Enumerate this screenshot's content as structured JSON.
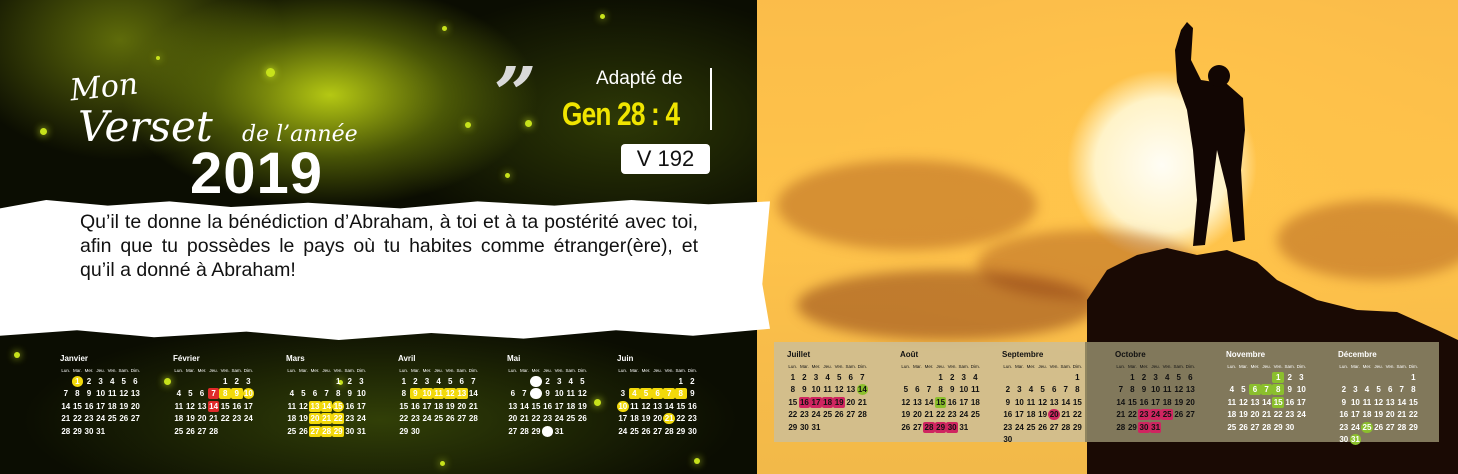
{
  "header": {
    "title_mon": "Mon",
    "title_verset": "Verset",
    "title_annee": "de l’année",
    "year": "2019",
    "quote_mark": "”",
    "adapted_label": "Adapté de",
    "reference": "Gen 28 : 4",
    "version": "V 192"
  },
  "verse": {
    "text": "Qu’il te donne la bénédiction d’Abraham, à toi et à ta postérité avec toi, afin que tu possèdes le pays où tu habites comme étranger(ère), et qu’il a donné à Abraham!"
  },
  "weekdays": [
    "Lun.",
    "Mar.",
    "Mer.",
    "Jeu.",
    "Ven.",
    "Sam.",
    "Dim."
  ],
  "colors": {
    "accent_yellow": "#f2d90b",
    "accent_red": "#e02a2a",
    "accent_green": "#8bbf2d",
    "accent_pink": "#cf2560",
    "reference_yellow": "#f0e500"
  },
  "calendar": {
    "months": [
      {
        "name": "Janvier",
        "weeks": [
          [
            "",
            "1",
            "2",
            "3",
            "4",
            "5",
            "6"
          ],
          [
            "7",
            "8",
            "9",
            "10",
            "11",
            "12",
            "13"
          ],
          [
            "14",
            "15",
            "16",
            "17",
            "18",
            "19",
            "20"
          ],
          [
            "21",
            "22",
            "23",
            "24",
            "25",
            "26",
            "27"
          ],
          [
            "28",
            "29",
            "30",
            "31",
            "",
            "",
            ""
          ]
        ],
        "highlights": {
          "1": "circle-y"
        }
      },
      {
        "name": "Février",
        "weeks": [
          [
            "",
            "",
            "",
            "",
            "1",
            "2",
            "3"
          ],
          [
            "4",
            "5",
            "6",
            "7",
            "8",
            "9",
            "10"
          ],
          [
            "11",
            "12",
            "13",
            "14",
            "15",
            "16",
            "17"
          ],
          [
            "18",
            "19",
            "20",
            "21",
            "22",
            "23",
            "24"
          ],
          [
            "25",
            "26",
            "27",
            "28",
            "",
            "",
            ""
          ]
        ],
        "highlights": {
          "7": "red",
          "8": "yellow",
          "9": "yellow",
          "10": "circle-y",
          "14": "red"
        }
      },
      {
        "name": "Mars",
        "weeks": [
          [
            "",
            "",
            "",
            "",
            "1",
            "2",
            "3"
          ],
          [
            "4",
            "5",
            "6",
            "7",
            "8",
            "9",
            "10"
          ],
          [
            "11",
            "12",
            "13",
            "14",
            "15",
            "16",
            "17"
          ],
          [
            "18",
            "19",
            "20",
            "21",
            "22",
            "23",
            "24"
          ],
          [
            "25",
            "26",
            "27",
            "28",
            "29",
            "30",
            "31"
          ]
        ],
        "highlights": {
          "13": "yellow",
          "14": "yellow",
          "15": "circle-y",
          "20": "yellow",
          "21": "yellow",
          "22": "yellow",
          "27": "yellow",
          "28": "yellow",
          "29": "yellow"
        }
      },
      {
        "name": "Avril",
        "weeks": [
          [
            "1",
            "2",
            "3",
            "4",
            "5",
            "6",
            "7"
          ],
          [
            "8",
            "9",
            "10",
            "11",
            "12",
            "13",
            "14"
          ],
          [
            "15",
            "16",
            "17",
            "18",
            "19",
            "20",
            "21"
          ],
          [
            "22",
            "23",
            "24",
            "25",
            "26",
            "27",
            "28"
          ],
          [
            "29",
            "30",
            "",
            "",
            "",
            "",
            ""
          ]
        ],
        "highlights": {
          "9": "yellow",
          "10": "yellow",
          "11": "yellow",
          "12": "yellow",
          "13": "yellow"
        }
      },
      {
        "name": "Mai",
        "weeks": [
          [
            "",
            "",
            "1",
            "2",
            "3",
            "4",
            "5"
          ],
          [
            "6",
            "7",
            "8",
            "9",
            "10",
            "11",
            "12"
          ],
          [
            "13",
            "14",
            "15",
            "16",
            "17",
            "18",
            "19"
          ],
          [
            "20",
            "21",
            "22",
            "23",
            "24",
            "25",
            "26"
          ],
          [
            "27",
            "28",
            "29",
            "30",
            "31",
            "",
            ""
          ]
        ],
        "highlights": {
          "1": "circle",
          "8": "circle",
          "30": "circle"
        }
      },
      {
        "name": "Juin",
        "weeks": [
          [
            "",
            "",
            "",
            "",
            "",
            "1",
            "2"
          ],
          [
            "3",
            "4",
            "5",
            "6",
            "7",
            "8",
            "9"
          ],
          [
            "10",
            "11",
            "12",
            "13",
            "14",
            "15",
            "16"
          ],
          [
            "17",
            "18",
            "19",
            "20",
            "21",
            "22",
            "23"
          ],
          [
            "24",
            "25",
            "26",
            "27",
            "28",
            "29",
            "30"
          ]
        ],
        "highlights": {
          "4": "yellow",
          "5": "yellow",
          "6": "yellow",
          "7": "yellow",
          "8": "yellow",
          "10": "circle-y",
          "21": "circle-y"
        }
      },
      {
        "name": "Juillet",
        "weeks": [
          [
            "1",
            "2",
            "3",
            "4",
            "5",
            "6",
            "7"
          ],
          [
            "8",
            "9",
            "10",
            "11",
            "12",
            "13",
            "14"
          ],
          [
            "15",
            "16",
            "17",
            "18",
            "19",
            "20",
            "21"
          ],
          [
            "22",
            "23",
            "24",
            "25",
            "26",
            "27",
            "28"
          ],
          [
            "29",
            "30",
            "31",
            "",
            "",
            "",
            ""
          ]
        ],
        "highlights": {
          "14": "circle-g",
          "16": "pink",
          "17": "pink",
          "18": "pink",
          "19": "pink"
        }
      },
      {
        "name": "Août",
        "weeks": [
          [
            "",
            "",
            "",
            "1",
            "2",
            "3",
            "4"
          ],
          [
            "5",
            "6",
            "7",
            "8",
            "9",
            "10",
            "11"
          ],
          [
            "12",
            "13",
            "14",
            "15",
            "16",
            "17",
            "18"
          ],
          [
            "19",
            "20",
            "21",
            "22",
            "23",
            "24",
            "25"
          ],
          [
            "26",
            "27",
            "28",
            "29",
            "30",
            "31",
            ""
          ]
        ],
        "highlights": {
          "15": "green",
          "28": "pink",
          "29": "pink",
          "30": "pink"
        }
      },
      {
        "name": "Septembre",
        "weeks": [
          [
            "",
            "",
            "",
            "",
            "",
            "",
            "1"
          ],
          [
            "2",
            "3",
            "4",
            "5",
            "6",
            "7",
            "8"
          ],
          [
            "9",
            "10",
            "11",
            "12",
            "13",
            "14",
            "15"
          ],
          [
            "16",
            "17",
            "18",
            "19",
            "20",
            "21",
            "22"
          ],
          [
            "23",
            "24",
            "25",
            "26",
            "27",
            "28",
            "29"
          ],
          [
            "30",
            "",
            "",
            "",
            "",
            "",
            ""
          ]
        ],
        "highlights": {
          "20": "circle-p"
        }
      },
      {
        "name": "Octobre",
        "weeks": [
          [
            "",
            "1",
            "2",
            "3",
            "4",
            "5",
            "6"
          ],
          [
            "7",
            "8",
            "9",
            "10",
            "11",
            "12",
            "13"
          ],
          [
            "14",
            "15",
            "16",
            "17",
            "18",
            "19",
            "20"
          ],
          [
            "21",
            "22",
            "23",
            "24",
            "25",
            "26",
            "27"
          ],
          [
            "28",
            "29",
            "30",
            "31",
            "",
            "",
            ""
          ]
        ],
        "highlights": {
          "23": "pink",
          "24": "pink",
          "25": "pink",
          "30": "pink",
          "31": "pink"
        }
      },
      {
        "name": "Novembre",
        "weeks": [
          [
            "",
            "",
            "",
            "",
            "1",
            "2",
            "3"
          ],
          [
            "4",
            "5",
            "6",
            "7",
            "8",
            "9",
            "10"
          ],
          [
            "11",
            "12",
            "13",
            "14",
            "15",
            "16",
            "17"
          ],
          [
            "18",
            "19",
            "20",
            "21",
            "22",
            "23",
            "24"
          ],
          [
            "25",
            "26",
            "27",
            "28",
            "29",
            "30",
            ""
          ]
        ],
        "highlights": {
          "1": "green",
          "6": "green",
          "7": "green",
          "8": "green",
          "15": "green"
        }
      },
      {
        "name": "Décembre",
        "weeks": [
          [
            "",
            "",
            "",
            "",
            "",
            "",
            "1"
          ],
          [
            "2",
            "3",
            "4",
            "5",
            "6",
            "7",
            "8"
          ],
          [
            "9",
            "10",
            "11",
            "12",
            "13",
            "14",
            "15"
          ],
          [
            "16",
            "17",
            "18",
            "19",
            "20",
            "21",
            "22"
          ],
          [
            "23",
            "24",
            "25",
            "26",
            "27",
            "28",
            "29"
          ],
          [
            "30",
            "31",
            "",
            "",
            "",
            "",
            ""
          ]
        ],
        "highlights": {
          "25": "circle-g",
          "31": "circle-g"
        }
      }
    ]
  }
}
